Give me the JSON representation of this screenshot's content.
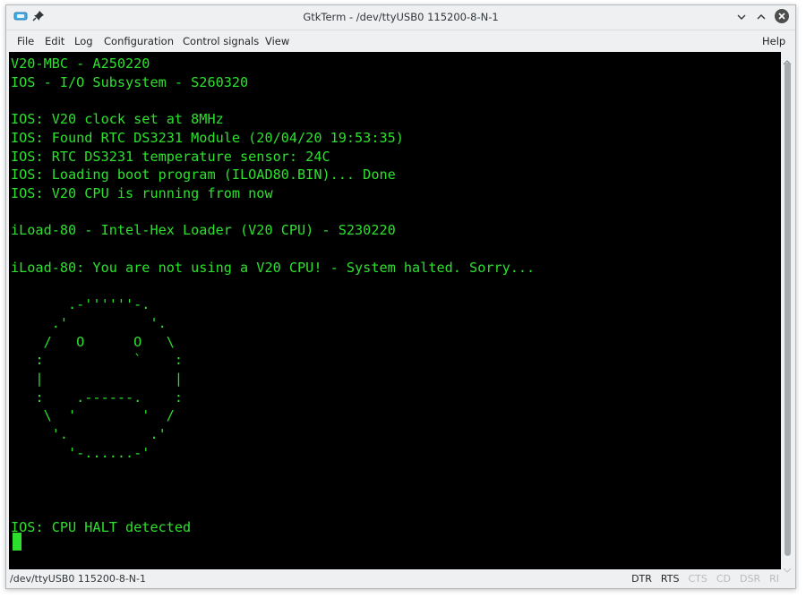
{
  "window": {
    "title": "GtkTerm - /dev/ttyUSB0 115200-8-N-1"
  },
  "menu": {
    "file": "File",
    "edit": "Edit",
    "log": "Log",
    "configuration": "Configuration",
    "control_signals": "Control signals",
    "view": "View",
    "help": "Help"
  },
  "terminal": {
    "text": "V20-MBC - A250220\nIOS - I/O Subsystem - S260320\n\nIOS: V20 clock set at 8MHz\nIOS: Found RTC DS3231 Module (20/04/20 19:53:35)\nIOS: RTC DS3231 temperature sensor: 24C\nIOS: Loading boot program (ILOAD80.BIN)... Done\nIOS: V20 CPU is running from now\n\niLoad-80 - Intel-Hex Loader (V20 CPU) - S230220\n\niLoad-80: You are not using a V20 CPU! - System halted. Sorry...\n\n       .-''''''-.\n     .'          '.\n    /   O      O   \\\n   :           `    :\n   |                |\n   :    .------.    :\n    \\  '        '  /\n     '.          .'\n       '-......-'\n\n\n\nIOS: CPU HALT detected",
    "fg_color": "#2de02d",
    "bg_color": "#000000"
  },
  "status": {
    "port": "/dev/ttyUSB0  115200-8-N-1",
    "signals": [
      {
        "label": "DTR",
        "active": true
      },
      {
        "label": "RTS",
        "active": true
      },
      {
        "label": "CTS",
        "active": false
      },
      {
        "label": "CD",
        "active": false
      },
      {
        "label": "DSR",
        "active": false
      },
      {
        "label": "RI",
        "active": false
      }
    ]
  }
}
